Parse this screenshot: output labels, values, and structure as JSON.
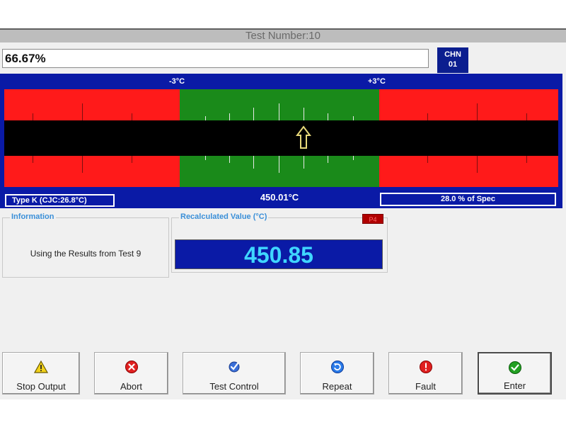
{
  "title": "Test Number:10",
  "progress_text": "66.67%",
  "channel": {
    "line1": "CHN",
    "line2": "01"
  },
  "meter": {
    "left_limit": "-3°C",
    "right_limit": "+3°C",
    "reading": "450.01°C",
    "type_label": "Type K (CJC:26.8°C)",
    "spec_label": "28.0 % of Spec",
    "colors": {
      "out_of_range": "#ff1a1a",
      "in_range": "#1a8a1a",
      "background": "#0a1aa6"
    }
  },
  "information": {
    "title": "Information",
    "text": "Using the Results from Test 9"
  },
  "recalculated": {
    "title": "Recalculated Value (°C)",
    "badge": "P4",
    "value": "450.85"
  },
  "buttons": [
    {
      "label": "Stop Output",
      "icon": "warning-icon"
    },
    {
      "label": "Abort",
      "icon": "abort-icon"
    },
    {
      "label": "Test Control",
      "icon": "checkmark-icon"
    },
    {
      "label": "Repeat",
      "icon": "repeat-icon"
    },
    {
      "label": "Fault",
      "icon": "fault-icon"
    },
    {
      "label": "Enter",
      "icon": "check-circle-icon"
    }
  ]
}
